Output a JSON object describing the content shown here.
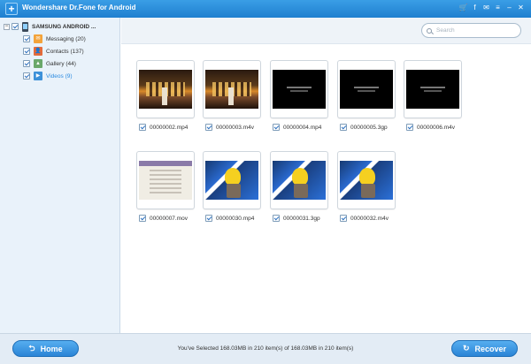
{
  "app": {
    "title": "Wondershare Dr.Fone for Android"
  },
  "titlebar_icons": [
    "cart-icon",
    "facebook-icon",
    "feedback-icon",
    "menu-icon",
    "minimize-icon",
    "close-icon"
  ],
  "titlebar_glyphs": {
    "cart": "🛒",
    "facebook": "f",
    "feedback": "✉",
    "menu": "≡",
    "minimize": "–",
    "close": "✕"
  },
  "sidebar": {
    "device": {
      "label": "SAMSUNG ANDROID ...",
      "expander": "−",
      "checked": true
    },
    "items": [
      {
        "label": "Messaging (20)",
        "icon": "messaging-icon",
        "glyph": "✉",
        "checked": true
      },
      {
        "label": "Contacts (137)",
        "icon": "contacts-icon",
        "glyph": "👤",
        "checked": true
      },
      {
        "label": "Gallery (44)",
        "icon": "gallery-icon",
        "glyph": "▲",
        "checked": true
      },
      {
        "label": "Videos (9)",
        "icon": "videos-icon",
        "glyph": "▶",
        "checked": true,
        "selected": true
      }
    ]
  },
  "search": {
    "placeholder": "Search"
  },
  "files": [
    {
      "name": "00000002.mp4",
      "checked": true
    },
    {
      "name": "00000003.m4v",
      "checked": true
    },
    {
      "name": "00000004.mp4",
      "checked": true
    },
    {
      "name": "00000005.3gp",
      "checked": true
    },
    {
      "name": "00000006.m4v",
      "checked": true
    },
    {
      "name": "00000007.mov",
      "checked": true
    },
    {
      "name": "00000030.mp4",
      "checked": true
    },
    {
      "name": "00000031.3gp",
      "checked": true
    },
    {
      "name": "00000032.m4v",
      "checked": true
    }
  ],
  "footer": {
    "home_label": "Home",
    "recover_label": "Recover",
    "status": "You've Selected 168.03MB in 210 item(s) of 168.03MB in 210 item(s)"
  },
  "colors": {
    "titlebar": "#1f7fcf",
    "accent": "#2b8be0",
    "sidebar_bg": "#e9f2fa"
  }
}
